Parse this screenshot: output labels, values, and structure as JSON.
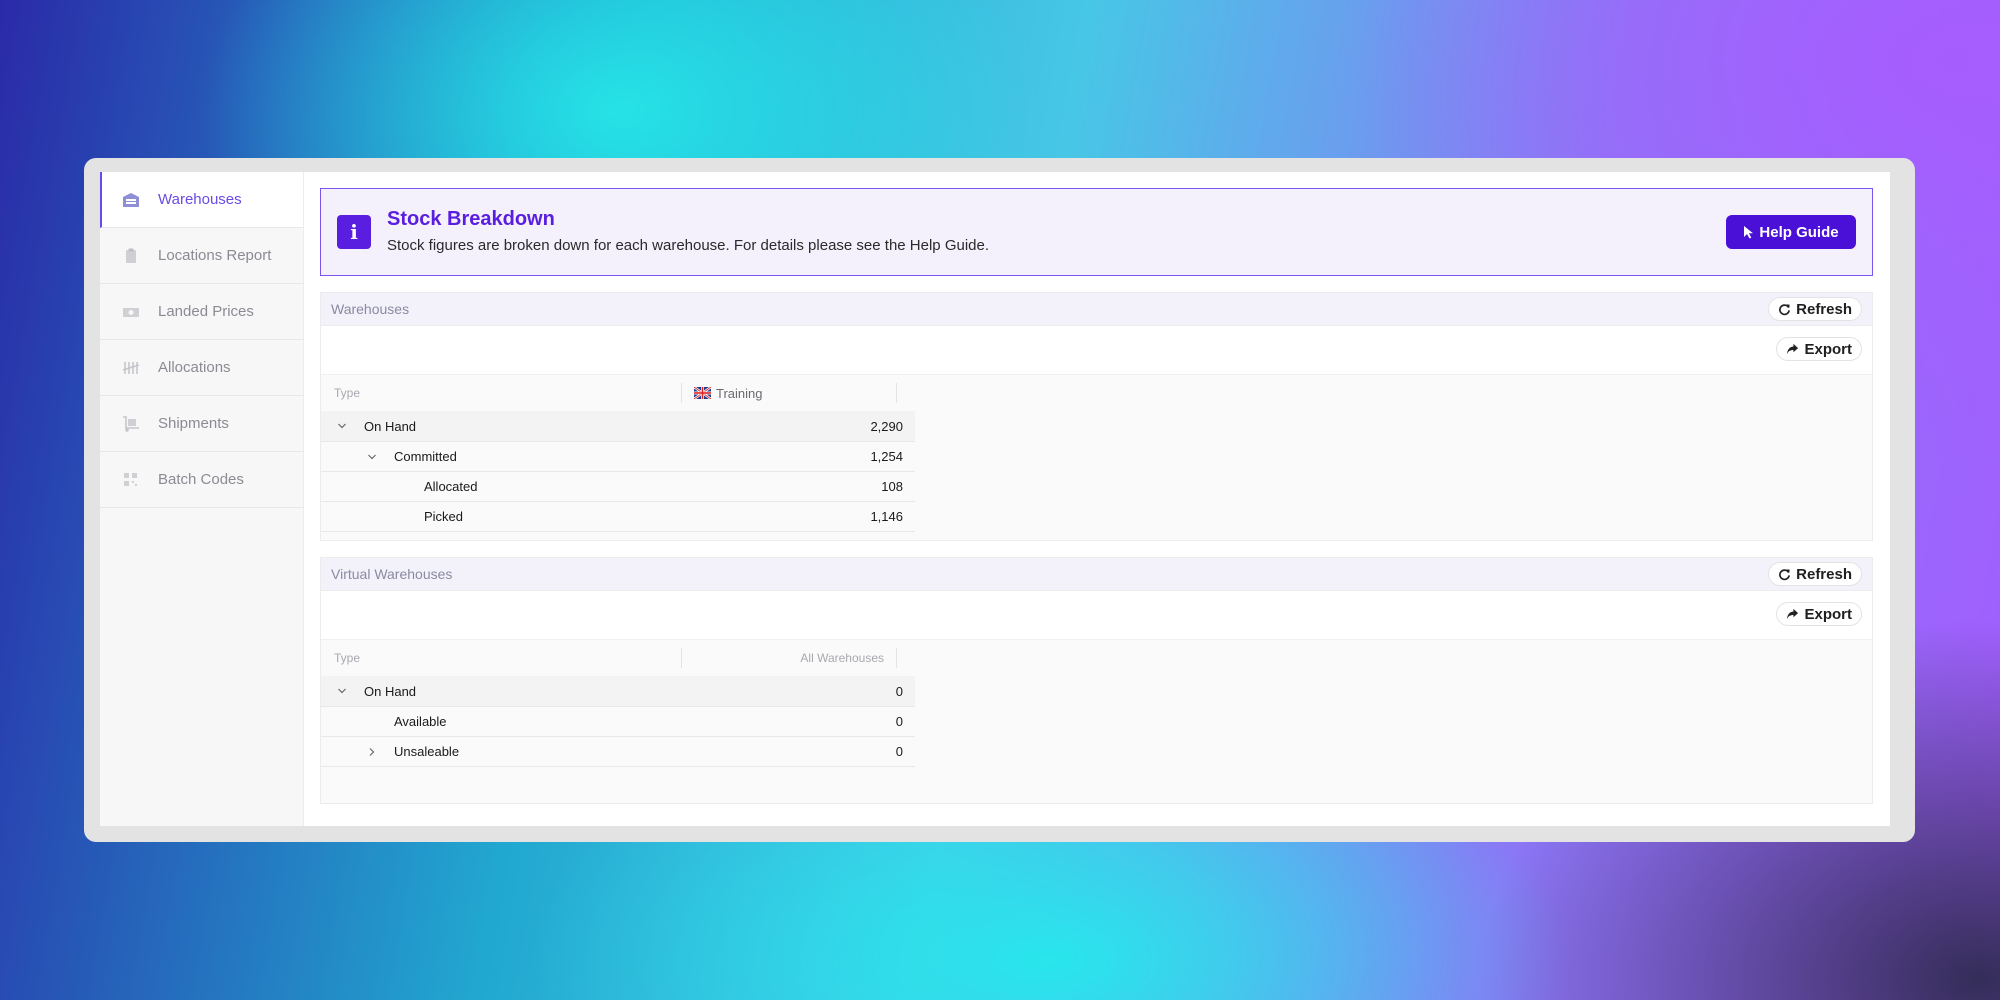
{
  "sidebar": {
    "items": [
      {
        "label": "Warehouses",
        "icon": "warehouse-icon",
        "active": true
      },
      {
        "label": "Locations Report",
        "icon": "clipboard-icon"
      },
      {
        "label": "Landed Prices",
        "icon": "money-icon"
      },
      {
        "label": "Allocations",
        "icon": "tally-icon"
      },
      {
        "label": "Shipments",
        "icon": "dolly-icon"
      },
      {
        "label": "Batch Codes",
        "icon": "barcode-icon"
      }
    ]
  },
  "banner": {
    "title": "Stock Breakdown",
    "text": "Stock figures are broken down for each warehouse. For details please see the Help Guide.",
    "help_label": "Help Guide"
  },
  "warehouses": {
    "title": "Warehouses",
    "refresh_label": "Refresh",
    "export_label": "Export",
    "col_type": "Type",
    "col_value": "Training",
    "rows": [
      {
        "label": "On Hand",
        "value": "2,290"
      },
      {
        "label": "Committed",
        "value": "1,254"
      },
      {
        "label": "Allocated",
        "value": "108"
      },
      {
        "label": "Picked",
        "value": "1,146"
      }
    ]
  },
  "virtual": {
    "title": "Virtual Warehouses",
    "refresh_label": "Refresh",
    "export_label": "Export",
    "col_type": "Type",
    "col_value": "All Warehouses",
    "rows": [
      {
        "label": "On Hand",
        "value": "0"
      },
      {
        "label": "Available",
        "value": "0"
      },
      {
        "label": "Unsaleable",
        "value": "0"
      }
    ]
  },
  "colors": {
    "accent": "#5a1ee0",
    "active_nav": "#6a4be6",
    "banner_bg": "#f4f1fd"
  }
}
